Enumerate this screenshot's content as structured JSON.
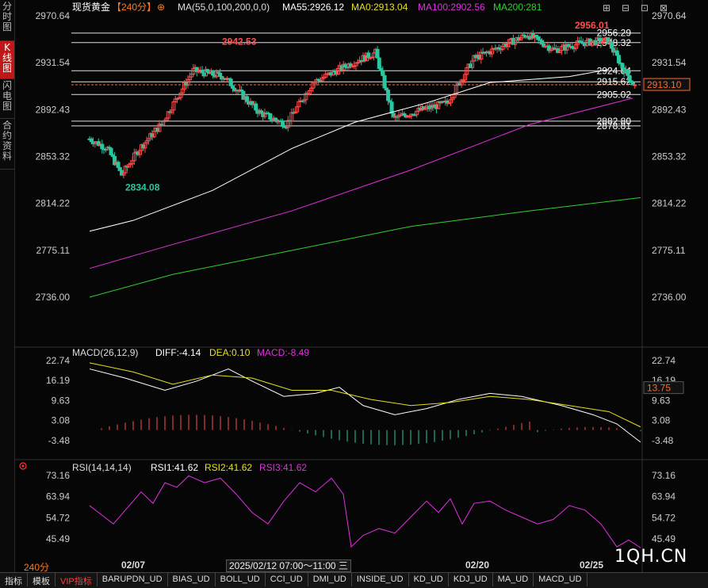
{
  "side_tabs": [
    "分时图",
    "K线图",
    "闪电图",
    "合约资料"
  ],
  "active_side_tab": 1,
  "header": {
    "symbol": "现货黄金",
    "period_tag": "【240分】",
    "ma_label": "MA(55,0,100,200,0,0)",
    "ma55": "MA55:2926.12",
    "ma0": "MA0:2913.04",
    "ma100": "MA100:2902.56",
    "ma200": "MA200:281"
  },
  "colors": {
    "up": "#ff4d4d",
    "down": "#29c7a0",
    "ma55": "#ffffff",
    "ma100": "#e030e0",
    "ma200": "#30d030",
    "dea": "#e8e020"
  },
  "price_axis": [
    "2970.64",
    "2931.54",
    "2892.43",
    "2853.32",
    "2814.22",
    "2775.11",
    "2736.00"
  ],
  "price_axis_range": [
    2736.0,
    2970.64
  ],
  "level_labels": [
    "2956.29",
    "2948.32",
    "2924.84",
    "2915.62",
    "2905.02",
    "2882.80",
    "2878.81"
  ],
  "last_price": "2913.10",
  "marks": {
    "high1": "2942.53",
    "high2": "2956.01",
    "low1": "2834.08"
  },
  "macd": {
    "title": "MACD(26,12,9)",
    "diff": "DIFF:-4.14",
    "dea": "DEA:0.10",
    "macd": "MACD:-8.49",
    "axis": [
      "22.74",
      "16.19",
      "9.63",
      "3.08",
      "-3.48"
    ],
    "axis_range": [
      -3.48,
      22.74
    ],
    "last": "13.75"
  },
  "rsi": {
    "title": "RSI(14,14,14)",
    "rsi1": "RSI1:41.62",
    "rsi2": "RSI2:41.62",
    "rsi3": "RSI3:41.62",
    "axis": [
      "73.16",
      "63.94",
      "54.72",
      "45.49"
    ],
    "axis_range": [
      45.49,
      73.16
    ]
  },
  "dates": [
    "02/07",
    "02/20",
    "02/25"
  ],
  "period_label": "240分",
  "crosshair_time": "2025/02/12 07:00～11:00 三",
  "bottom_tabs": [
    "指标",
    "模板",
    "VIP指标",
    "BARUPDN_UD",
    "BIAS_UD",
    "BOLL_UD",
    "CCI_UD",
    "DMI_UD",
    "INSIDE_UD",
    "KD_UD",
    "KDJ_UD",
    "MA_UD",
    "MACD_UD"
  ],
  "watermark": "1QH.CN"
}
